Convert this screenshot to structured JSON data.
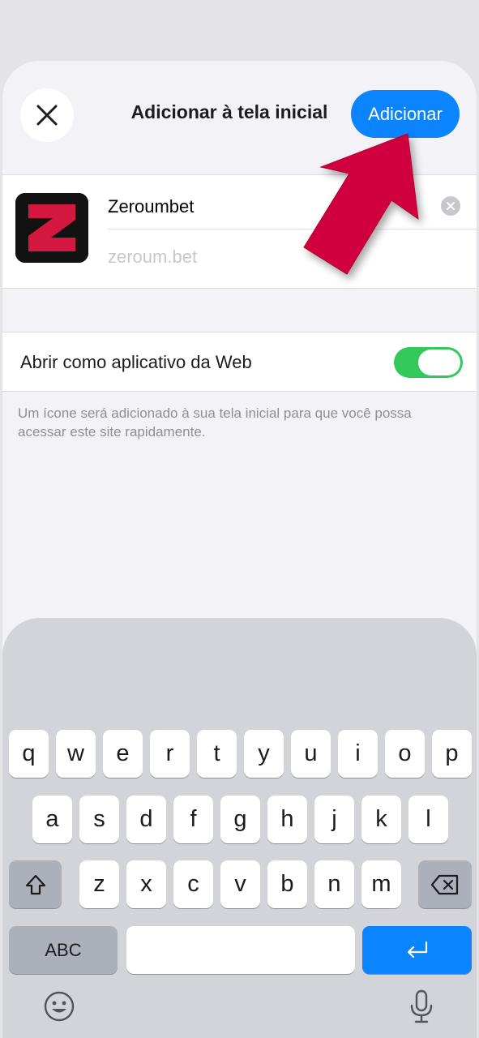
{
  "header": {
    "title": "Adicionar à tela inicial",
    "add_label": "Adicionar"
  },
  "app": {
    "name": "Zeroumbet",
    "url": "zeroum.bet",
    "icon_letter": "Z"
  },
  "web_app_toggle": {
    "label": "Abrir como aplicativo da Web",
    "on": true
  },
  "note": "Um ícone será adicionado à sua tela inicial para que você possa acessar este site rapidamente.",
  "keyboard": {
    "row1": [
      "q",
      "w",
      "e",
      "r",
      "t",
      "y",
      "u",
      "i",
      "o",
      "p"
    ],
    "row2": [
      "a",
      "s",
      "d",
      "f",
      "g",
      "h",
      "j",
      "k",
      "l"
    ],
    "row3": [
      "z",
      "x",
      "c",
      "v",
      "b",
      "n",
      "m"
    ],
    "abc_label": "ABC"
  },
  "colors": {
    "accent": "#0a84ff",
    "toggle_on": "#34c759",
    "arrow": "#d0063f",
    "logo_red": "#d5183f"
  }
}
